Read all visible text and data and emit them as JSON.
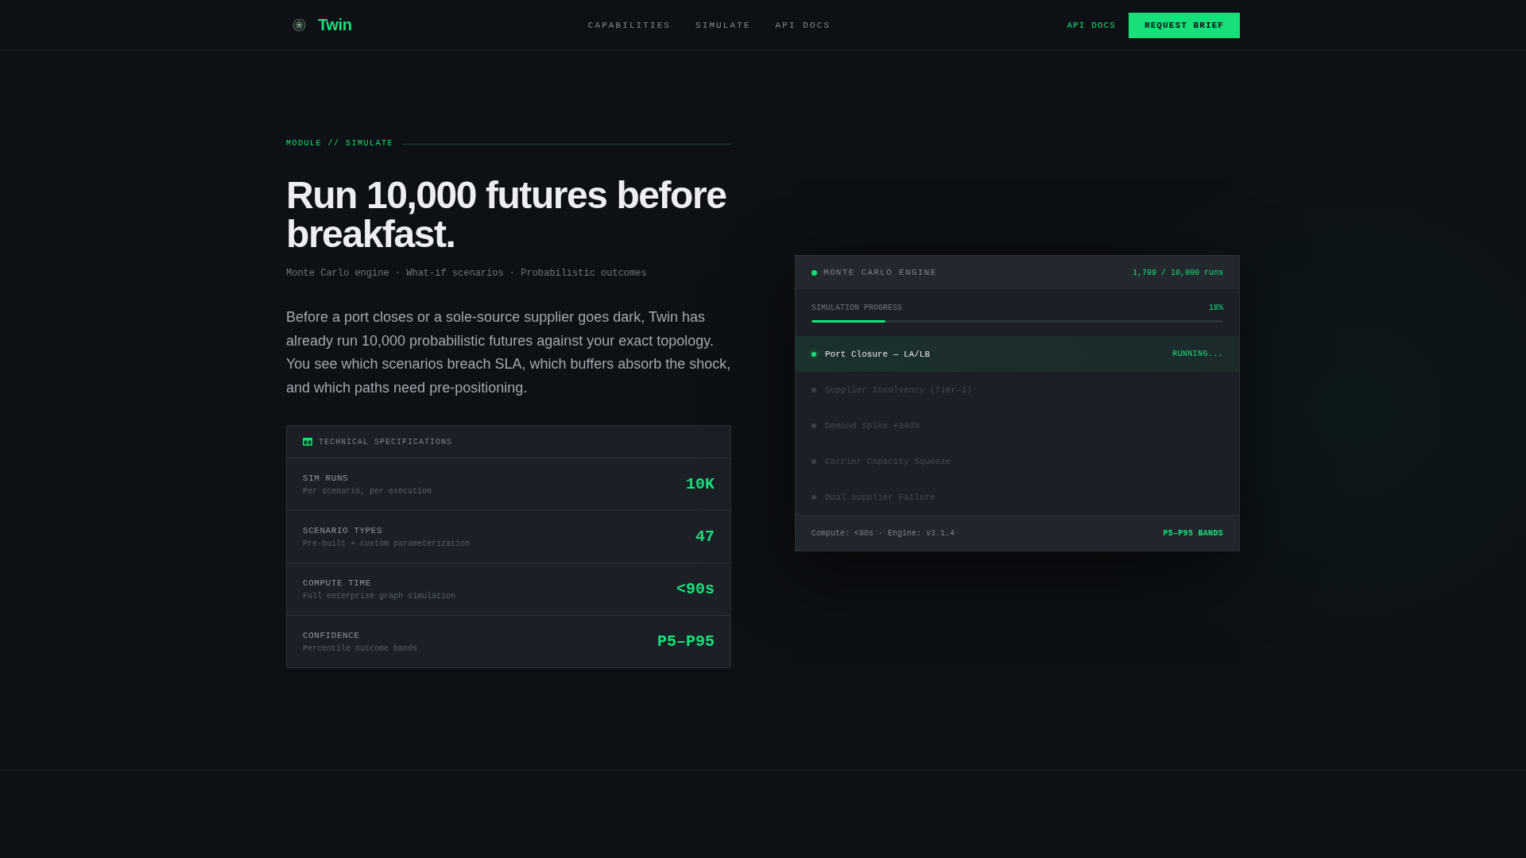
{
  "header": {
    "brand": "Twin",
    "nav": [
      "CAPABILITIES",
      "SIMULATE",
      "API DOCS"
    ],
    "link": "API DOCS",
    "button": "REQUEST BRIEF"
  },
  "hero": {
    "eyebrow": "MODULE // SIMULATE",
    "title": "Run 10,000 futures before breakfast.",
    "tagline": "Monte Carlo engine · What-if scenarios · Probabilistic outcomes",
    "body": "Before a port closes or a sole-source supplier goes dark, Twin has already run 10,000 probabilistic futures against your exact topology. You see which scenarios breach SLA, which buffers absorb the shock, and which paths need pre-positioning."
  },
  "specs": {
    "title": "TECHNICAL SPECIFICATIONS",
    "rows": [
      {
        "label": "SIM RUNS",
        "description": "Per scenario, per execution",
        "value": "10K"
      },
      {
        "label": "SCENARIO TYPES",
        "description": "Pre-built + custom parameterization",
        "value": "47"
      },
      {
        "label": "COMPUTE TIME",
        "description": "Full enterprise graph simulation",
        "value": "<90s"
      },
      {
        "label": "CONFIDENCE",
        "description": "Percentile outcome bands",
        "value": "P5–P95"
      }
    ]
  },
  "engine": {
    "title": "MONTE CARLO ENGINE",
    "runs": "1,799 / 10,000 runs",
    "progress": {
      "label": "SIMULATION PROGRESS",
      "reading": "18%",
      "level": 0.18
    },
    "scenarios": [
      {
        "name": "Port Closure — LA/LB",
        "status": "RUNNING...",
        "active": true
      },
      {
        "name": "Supplier Insolvency (Tier-1)",
        "active": false
      },
      {
        "name": "Demand Spike +340%",
        "active": false
      },
      {
        "name": "Carrier Capacity Squeeze",
        "active": false
      },
      {
        "name": "Dual Supplier Failure",
        "active": false
      }
    ],
    "footer": {
      "info": "Compute: <90s · Engine: v3.1.4",
      "badge": "P5–P95 BANDS"
    }
  }
}
